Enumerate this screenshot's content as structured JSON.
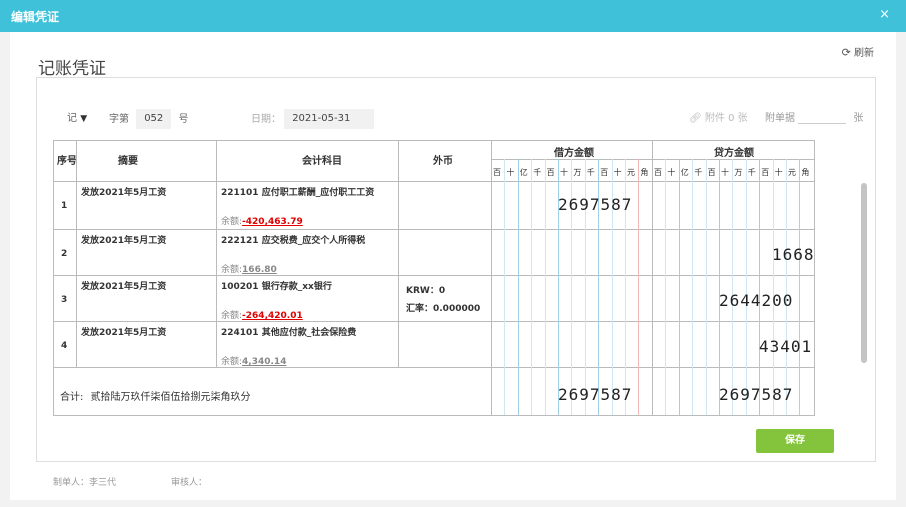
{
  "header": {
    "title": "编辑凭证",
    "close": "×"
  },
  "panel": {
    "voucher_title": "记账凭证",
    "refresh_label": "刷新"
  },
  "meta": {
    "voucher_type": "记",
    "zi_label": "字第",
    "number": "052",
    "hao_label": "号",
    "date_label": "日期：",
    "date_value": "2021-05-31",
    "attachment_label": "附件 0 张",
    "bills_label": "附单据",
    "bills_value": "",
    "zhang_label": "张"
  },
  "table": {
    "headers": {
      "seq": "序号",
      "summary": "摘要",
      "account": "会计科目",
      "foreign": "外币",
      "debit": "借方金额",
      "credit": "贷方金额"
    },
    "digit_units": [
      "百",
      "十",
      "亿",
      "千",
      "百",
      "十",
      "万",
      "千",
      "百",
      "十",
      "元",
      "角"
    ],
    "rows": [
      {
        "seq": "1",
        "summary": "发放2021年5月工资",
        "account": "221101 应付职工薪酬_应付职工工资",
        "balance_label": "余额:",
        "balance": "-420,463.79",
        "balance_neg": true,
        "fx": "",
        "rate": "",
        "debit": "2697587",
        "credit": ""
      },
      {
        "seq": "2",
        "summary": "发放2021年5月工资",
        "account": "222121 应交税费_应交个人所得税",
        "balance_label": "余额:",
        "balance": "166.80",
        "balance_neg": false,
        "fx": "",
        "rate": "",
        "debit": "",
        "credit": "1668"
      },
      {
        "seq": "3",
        "summary": "发放2021年5月工资",
        "account": "100201 银行存款_xx银行",
        "balance_label": "余额:",
        "balance": "-264,420.01",
        "balance_neg": true,
        "fx": "KRW：0",
        "rate": "汇率：0.000000",
        "debit": "",
        "credit": "2644200"
      },
      {
        "seq": "4",
        "summary": "发放2021年5月工资",
        "account": "224101 其他应付款_社会保险费",
        "balance_label": "余额:",
        "balance": "4,340.14",
        "balance_neg": false,
        "fx": "",
        "rate": "",
        "debit": "",
        "credit": "43401"
      }
    ],
    "total": {
      "label": "合计:",
      "words": "贰拾陆万玖仟柒佰伍拾捌元柒角玖分",
      "debit": "2697587",
      "credit": "2697587"
    }
  },
  "footer": {
    "maker_label": "制单人：",
    "maker": "李三代",
    "reviewer_label": "审核人：",
    "reviewer": ""
  },
  "save_label": "保存"
}
